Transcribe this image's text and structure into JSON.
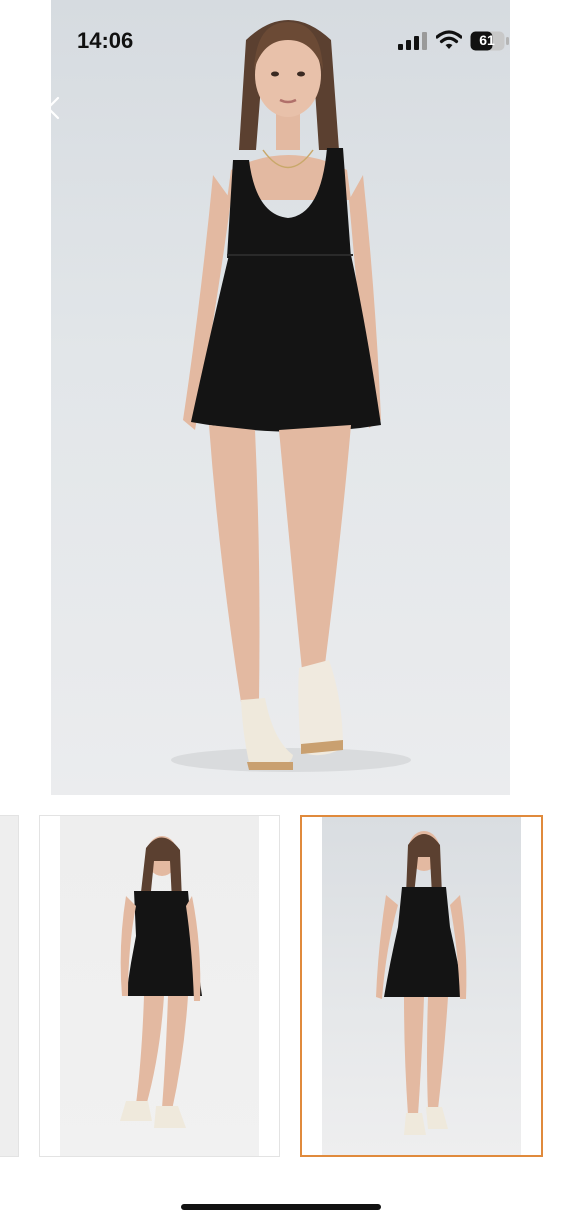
{
  "status_bar": {
    "time": "14:06",
    "battery_level": "61",
    "icons": [
      "signal-icon",
      "wifi-icon",
      "battery-icon"
    ]
  },
  "viewer": {
    "close_icon": "close-icon",
    "main_image_alt": "",
    "thumbnails": [
      {
        "name": "thumbnail-partial",
        "selected": false
      },
      {
        "name": "thumbnail-1",
        "selected": false
      },
      {
        "name": "thumbnail-2",
        "selected": true
      }
    ],
    "selected_border_color": "#e08a3c"
  },
  "colors": {
    "background": "#ffffff",
    "dress": "#141414",
    "skin": "#e3b9a1"
  }
}
